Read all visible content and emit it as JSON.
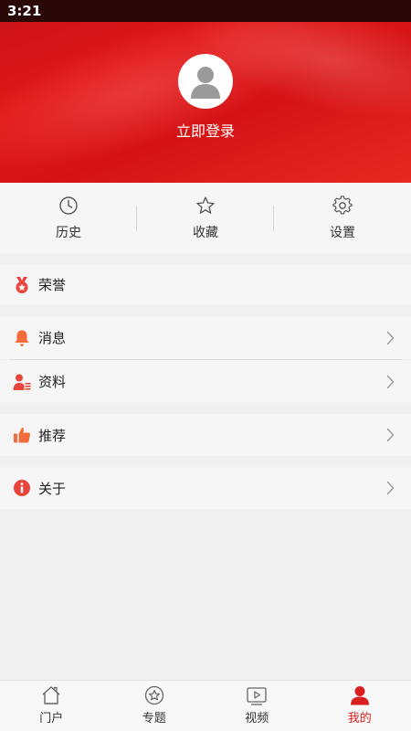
{
  "status_bar": {
    "time": "3:21"
  },
  "header": {
    "login_text": "立即登录"
  },
  "quick_actions": [
    {
      "label": "历史",
      "icon": "clock-icon"
    },
    {
      "label": "收藏",
      "icon": "star-icon"
    },
    {
      "label": "设置",
      "icon": "gear-icon"
    }
  ],
  "menu": {
    "honor": {
      "label": "荣誉",
      "icon": "medal-icon"
    },
    "messages": {
      "label": "消息",
      "icon": "bell-icon"
    },
    "profile": {
      "label": "资料",
      "icon": "profile-card-icon"
    },
    "recommend": {
      "label": "推荐",
      "icon": "thumbs-up-icon"
    },
    "about": {
      "label": "关于",
      "icon": "info-icon"
    }
  },
  "tabs": [
    {
      "label": "门户",
      "icon": "home-icon",
      "active": false
    },
    {
      "label": "专题",
      "icon": "star-circle-icon",
      "active": false
    },
    {
      "label": "视频",
      "icon": "video-icon",
      "active": false
    },
    {
      "label": "我的",
      "icon": "user-icon",
      "active": true
    }
  ],
  "colors": {
    "brand_red": "#d81e1e",
    "icon_orange": "#f26b3a",
    "icon_red": "#e8453c"
  }
}
